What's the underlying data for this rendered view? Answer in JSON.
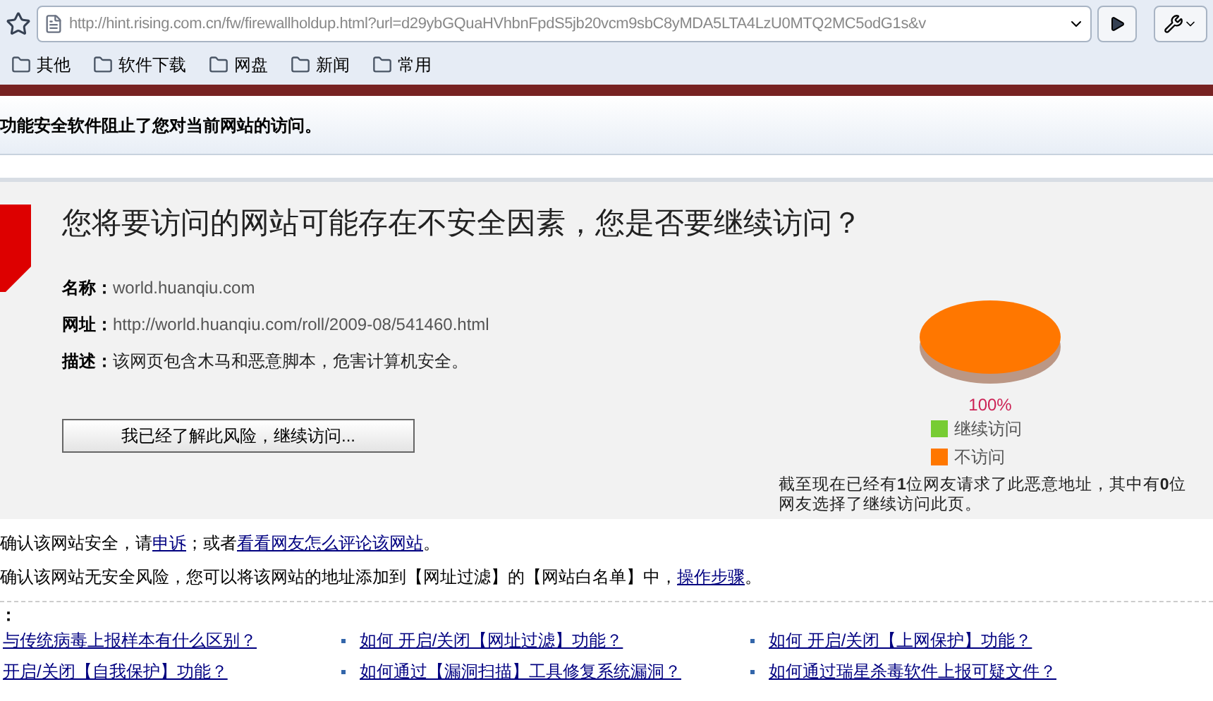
{
  "browser": {
    "url": "http://hint.rising.com.cn/fw/firewallholdup.html?url=d29ybGQuaHVhbnFpdS5jb20vcm9sbC8yMDA5LTA4LzU0MTQ2MC5odG1s&v",
    "bookmarks": [
      "其他",
      "软件下载",
      "网盘",
      "新闻",
      "常用"
    ]
  },
  "info_bar": "功能安全软件阻止了您对当前网站的访问。",
  "warning": {
    "title": "您将要访问的网站可能存在不安全因素，您是否要继续访问？",
    "fields": [
      {
        "label": "名称：",
        "value": "world.huanqiu.com",
        "kind": "gray"
      },
      {
        "label": "网址：",
        "value": "http://world.huanqiu.com/roll/2009-08/541460.html",
        "kind": "gray"
      },
      {
        "label": "描述：",
        "value": "该网页包含木马和恶意脚本，危害计算机安全。",
        "kind": "dark"
      }
    ],
    "continue_button": "我已经了解此风险，继续访问...",
    "chart_data": {
      "type": "pie",
      "categories": [
        "继续访问",
        "不访问"
      ],
      "values": [
        0,
        100
      ],
      "value_labels": [
        null,
        "100%"
      ]
    },
    "legend": [
      {
        "color": "#77cc33"
      },
      {
        "color": "#ff7700"
      }
    ],
    "stats": "截至现在已经有**1**位网友请求了此恶意地址，其中有**0**位网友选择了继续访问此页。"
  },
  "notes": [
    {
      "parts": [
        {
          "text": "确认该网站安全，请",
          "link": false
        },
        {
          "text": "申诉",
          "link": true
        },
        {
          "text": "；或者",
          "link": false
        },
        {
          "text": "看看网友怎么评论该网站",
          "link": true
        },
        {
          "text": "。",
          "link": false
        }
      ]
    },
    {
      "parts": [
        {
          "text": "确认该网站无安全风险，您可以将该网站的地址添加到【网址过滤】的【网站白名单】中，",
          "link": false
        },
        {
          "text": "操作步骤",
          "link": true
        },
        {
          "text": "。",
          "link": false
        }
      ]
    }
  ],
  "faq": {
    "heading": "：",
    "links": [
      "与传统病毒上报样本有什么区别？",
      "如何 开启/关闭【网址过滤】功能？",
      "如何 开启/关闭【上网保护】功能？",
      "开启/关闭【自我保护】功能？",
      "如何通过【漏洞扫描】工具修复系统漏洞？",
      "如何通过瑞星杀毒软件上报可疑文件？"
    ]
  }
}
